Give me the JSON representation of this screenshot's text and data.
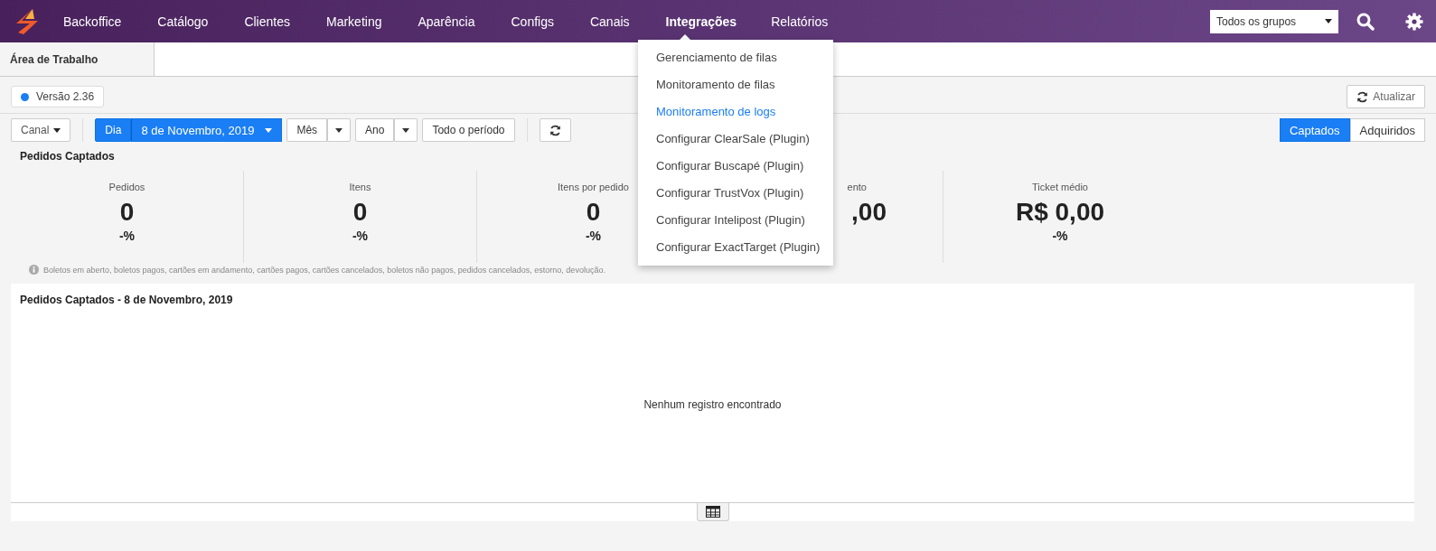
{
  "nav": {
    "items": [
      {
        "label": "Backoffice",
        "selected": false
      },
      {
        "label": "Catálogo",
        "selected": false
      },
      {
        "label": "Clientes",
        "selected": false
      },
      {
        "label": "Marketing",
        "selected": false
      },
      {
        "label": "Aparência",
        "selected": false
      },
      {
        "label": "Configs",
        "selected": false
      },
      {
        "label": "Canais",
        "selected": false
      },
      {
        "label": "Integrações",
        "selected": true
      },
      {
        "label": "Relatórios",
        "selected": false
      }
    ],
    "group_select": {
      "value": "Todos os grupos"
    }
  },
  "dropdown": {
    "items": [
      {
        "label": "Gerenciamento de filas",
        "selected": false
      },
      {
        "label": "Monitoramento de filas",
        "selected": false
      },
      {
        "label": "Monitoramento de logs",
        "selected": true
      },
      {
        "label": "Configurar ClearSale (Plugin)",
        "selected": false
      },
      {
        "label": "Configurar Buscapé (Plugin)",
        "selected": false
      },
      {
        "label": "Configurar TrustVox (Plugin)",
        "selected": false
      },
      {
        "label": "Configurar Intelipost (Plugin)",
        "selected": false
      },
      {
        "label": "Configurar ExactTarget (Plugin)",
        "selected": false
      }
    ]
  },
  "tabs": [
    {
      "label": "Área de Trabalho",
      "selected": true
    }
  ],
  "version": {
    "label": "Versão 2.36",
    "color": "#1a7ef5"
  },
  "refresh_button": "Atualizar",
  "toolbar": {
    "channel": "Canal",
    "periods": [
      {
        "label": "Dia",
        "value": "8 de Novembro, 2019",
        "selected": true
      },
      {
        "label": "Mês",
        "selected": false
      },
      {
        "label": "Ano",
        "selected": false
      }
    ],
    "all_period": "Todo o período"
  },
  "mode_toggle": [
    {
      "label": "Captados",
      "selected": true
    },
    {
      "label": "Adquiridos",
      "selected": false
    }
  ],
  "section_title": "Pedidos Captados",
  "metrics": [
    {
      "label": "Pedidos",
      "value": "0",
      "change": "-%"
    },
    {
      "label": "Itens",
      "value": "0",
      "change": "-%"
    },
    {
      "label": "Itens por pedido",
      "value": "0",
      "change": "-%"
    },
    {
      "label": "ento",
      "value": ",00",
      "partial": true
    },
    {
      "label": "Ticket médio",
      "value": "R$ 0,00",
      "change": "-%"
    }
  ],
  "note": "Boletos em aberto, boletos pagos, cartões em andamento, cartões pagos, cartões cancelados, boletos não pagos, pedidos cancelados, estorno, devolução.",
  "chart_panel": {
    "title": "Pedidos Captados - 8 de Novembro, 2019",
    "empty": "Nenhum registro encontrado"
  }
}
